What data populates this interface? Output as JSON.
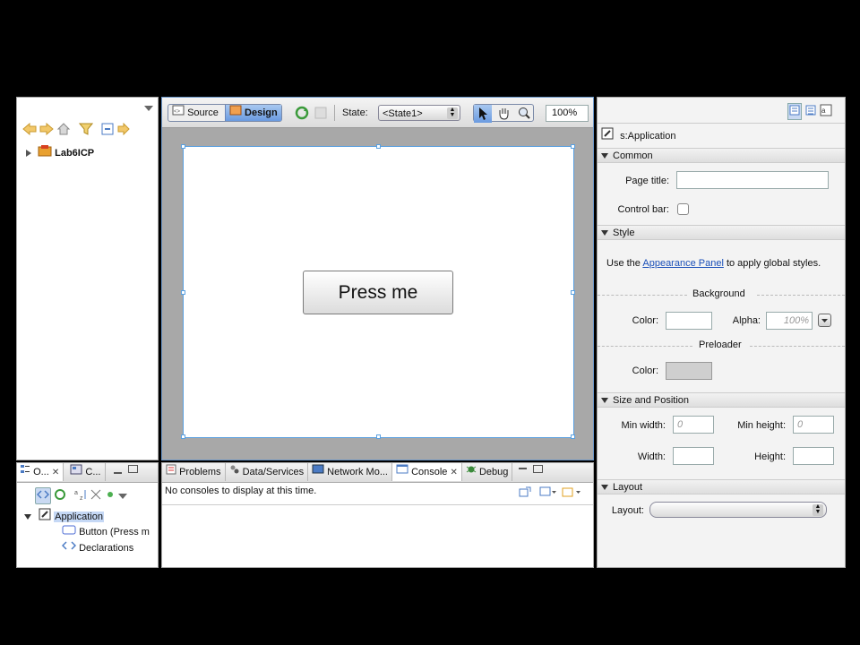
{
  "navigator": {
    "project": "Lab6ICP"
  },
  "editor": {
    "source_tab": "Source",
    "design_tab": "Design",
    "state_label": "State:",
    "state_value": "<State1>",
    "zoom": "100%",
    "canvas_button": "Press me"
  },
  "outline": {
    "tab1": "O...",
    "tab2": "C...",
    "items": [
      "Application",
      "Button (Press m",
      "Declarations"
    ]
  },
  "bottom": {
    "tabs": [
      "Problems",
      "Data/Services",
      "Network Mo...",
      "Console",
      "Debug"
    ],
    "message": "No consoles to display at this time."
  },
  "properties": {
    "component": "s:Application",
    "common_section": "Common",
    "page_title_label": "Page title:",
    "page_title_value": "",
    "control_bar_label": "Control bar:",
    "style_section": "Style",
    "use_the": "Use the",
    "appearance_link": "Appearance Panel",
    "to_apply": "to apply global styles.",
    "background_header": "Background",
    "color_label": "Color:",
    "alpha_label": "Alpha:",
    "alpha_value": "100%",
    "preloader_header": "Preloader",
    "preloader_color_label": "Color:",
    "size_section": "Size and Position",
    "min_width_label": "Min width:",
    "min_width_value": "0",
    "min_height_label": "Min height:",
    "min_height_value": "0",
    "width_label": "Width:",
    "height_label": "Height:",
    "layout_section": "Layout",
    "layout_label": "Layout:"
  }
}
